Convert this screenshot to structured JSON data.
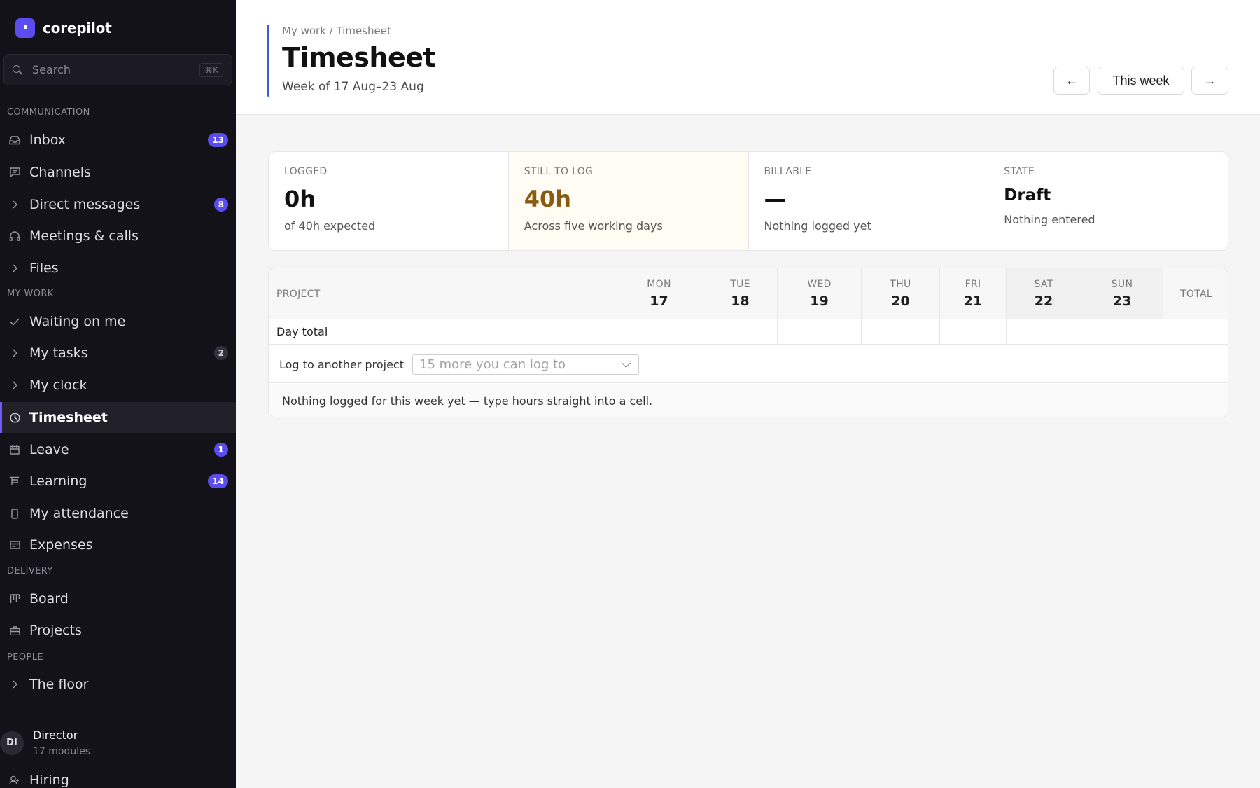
{
  "app": {
    "name": "corepilot"
  },
  "search": {
    "placeholder": "Search",
    "shortcut": "⌘K"
  },
  "sidebar": {
    "sections": [
      {
        "label": "COMMUNICATION"
      },
      {
        "label": "MY WORK"
      },
      {
        "label": "DELIVERY"
      },
      {
        "label": "PEOPLE"
      }
    ],
    "items": [
      {
        "label": "Inbox",
        "icon": "inbox-icon",
        "badge": "13"
      },
      {
        "label": "Channels",
        "icon": "chat-icon"
      },
      {
        "label": "Direct messages",
        "icon": "chevron-right-icon",
        "badge": "8"
      },
      {
        "label": "Meetings & calls",
        "icon": "headset-icon"
      },
      {
        "label": "Files",
        "icon": "chevron-right-icon"
      },
      {
        "label": "Waiting on me",
        "icon": "check-icon"
      },
      {
        "label": "My tasks",
        "icon": "chevron-right-icon",
        "badge": "2"
      },
      {
        "label": "My clock",
        "icon": "chevron-right-icon"
      },
      {
        "label": "Timesheet",
        "icon": "clock-icon",
        "active": true
      },
      {
        "label": "Leave",
        "icon": "calendar-icon",
        "badge": "1"
      },
      {
        "label": "Learning",
        "icon": "board-icon",
        "badge": "14"
      },
      {
        "label": "My attendance",
        "icon": "phone-icon"
      },
      {
        "label": "Expenses",
        "icon": "card-icon"
      },
      {
        "label": "Board",
        "icon": "kanban-icon"
      },
      {
        "label": "Projects",
        "icon": "briefcase-icon"
      },
      {
        "label": "The floor",
        "icon": "chevron-right-icon"
      },
      {
        "label": "Hiring",
        "icon": "user-add-icon"
      }
    ],
    "user": {
      "initials": "DI",
      "name": "Director",
      "sub": "17 modules"
    }
  },
  "header": {
    "breadcrumb": "My work / Timesheet",
    "title": "Timesheet",
    "subtitle": "Week of 17 Aug–23 Aug",
    "prev_label": "←",
    "week_label": "This week",
    "next_label": "→"
  },
  "stats": [
    {
      "label": "LOGGED",
      "value": "0h",
      "note": "of 40h expected"
    },
    {
      "label": "STILL TO LOG",
      "value": "40h",
      "note": "Across five working days"
    },
    {
      "label": "BILLABLE",
      "value": "—",
      "note": "Nothing logged yet"
    },
    {
      "label": "STATE",
      "value": "Draft",
      "note": "Nothing entered"
    }
  ],
  "table": {
    "project_header": "PROJECT",
    "total_header": "TOTAL",
    "days": [
      {
        "day": "MON",
        "date": "17"
      },
      {
        "day": "TUE",
        "date": "18"
      },
      {
        "day": "WED",
        "date": "19"
      },
      {
        "day": "THU",
        "date": "20"
      },
      {
        "day": "FRI",
        "date": "21"
      },
      {
        "day": "SAT",
        "date": "22"
      },
      {
        "day": "SUN",
        "date": "23"
      }
    ],
    "day_total_label": "Day total",
    "log_label": "Log to another project",
    "log_select_value": "15 more you can log to",
    "empty_message": "Nothing logged for this week yet — type hours straight into a cell."
  },
  "colors": {
    "accent": "#5b4cf0",
    "sidebar_bg": "#141219",
    "warn_text": "#8a5a10",
    "header_bar": "#3d5ed8"
  }
}
